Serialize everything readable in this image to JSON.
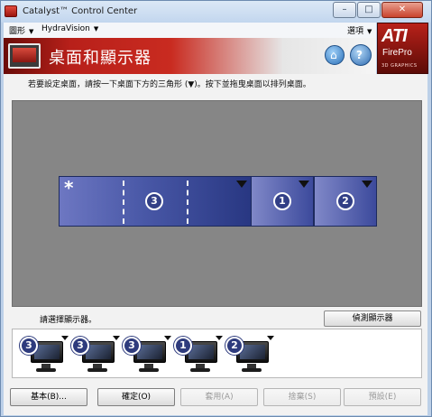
{
  "window": {
    "title": "Catalyst™ Control Center"
  },
  "titlebar_buttons": {
    "minimize": "–",
    "maximize": "□",
    "close": "✕"
  },
  "menubar": [
    {
      "label": "圖形",
      "arrow": "▼"
    },
    {
      "label": "HydraVision",
      "arrow": "▼"
    },
    {
      "label": "選項",
      "arrow": "▼"
    }
  ],
  "banner": {
    "title": "桌面和顯示器",
    "home_glyph": "⌂",
    "help_glyph": "?"
  },
  "logo": {
    "brand": "ATI",
    "product": "FirePro",
    "tagline": "3D GRAPHICS"
  },
  "instruction": "若要設定桌面，請按一下桌面下方的三角形 (▼)。按下並拖曳桌面以排列桌面。",
  "desktops": [
    {
      "number": "3",
      "primary": true,
      "primary_marker": "*"
    },
    {
      "number": "1",
      "primary": false
    },
    {
      "number": "2",
      "primary": false
    }
  ],
  "select_display_label": "請選擇顯示器。",
  "detect_button": "偵測顯示器",
  "monitors": [
    {
      "number": "3"
    },
    {
      "number": "3"
    },
    {
      "number": "3"
    },
    {
      "number": "1"
    },
    {
      "number": "2"
    }
  ],
  "buttons": {
    "basic": "基本(B)...",
    "ok": "確定(O)",
    "apply": "套用(A)",
    "discard": "捨棄(S)",
    "defaults": "預設(E)"
  },
  "colors": {
    "banner_red": "#c92b20",
    "desktop_blue": "#4857a6",
    "canvas_gray": "#868686"
  }
}
